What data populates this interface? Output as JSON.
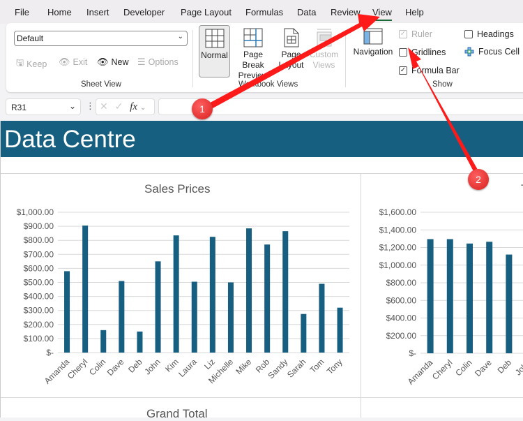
{
  "menu": {
    "tabs": [
      {
        "label": "File"
      },
      {
        "label": "Home"
      },
      {
        "label": "Insert"
      },
      {
        "label": "Developer"
      },
      {
        "label": "Page Layout"
      },
      {
        "label": "Formulas"
      },
      {
        "label": "Data"
      },
      {
        "label": "Review"
      },
      {
        "label": "View",
        "active": true
      },
      {
        "label": "Help"
      }
    ]
  },
  "ribbon": {
    "sheet_view": {
      "label": "Sheet View",
      "select_value": "Default",
      "keep": "Keep",
      "exit": "Exit",
      "new": "New",
      "options": "Options"
    },
    "workbook_views": {
      "label": "Workbook Views",
      "normal": "Normal",
      "page_break_1": "Page Break",
      "page_break_2": "Preview",
      "page_layout_1": "Page",
      "page_layout_2": "Layout",
      "custom_views_1": "Custom",
      "custom_views_2": "Views"
    },
    "navigation": {
      "label": "Navigation"
    },
    "show": {
      "label": "Show",
      "ruler": {
        "label": "Ruler",
        "checked": true,
        "enabled": false
      },
      "gridlines": {
        "label": "Gridlines",
        "checked": false
      },
      "formula_bar": {
        "label": "Formula Bar",
        "checked": true
      },
      "headings": {
        "label": "Headings",
        "checked": false
      },
      "focus_cell": {
        "label": "Focus Cell"
      }
    }
  },
  "formula_bar": {
    "name_box": "R31",
    "fx": "fx",
    "value": ""
  },
  "sheet": {
    "banner_title": "Data Centre",
    "grand_total_title": "Grand Total",
    "banner_color": "#175f80"
  },
  "annotations": [
    {
      "number": "1"
    },
    {
      "number": "2"
    }
  ],
  "chart_data": [
    {
      "type": "bar",
      "title": "Sales Prices",
      "xlabel": "",
      "ylabel": "",
      "ylim": [
        0,
        1000
      ],
      "yticks": [
        "$-",
        "$100.00",
        "$200.00",
        "$300.00",
        "$400.00",
        "$500.00",
        "$600.00",
        "$700.00",
        "$800.00",
        "$900.00",
        "$1,000.00"
      ],
      "grid": true,
      "bar_color": "#175f80",
      "categories": [
        "Amanda",
        "Cheryl",
        "Colin",
        "Dave",
        "Deb",
        "John",
        "Kim",
        "Laura",
        "Liz",
        "Michelle",
        "Mike",
        "Rob",
        "Sandy",
        "Sarah",
        "Tom",
        "Tony"
      ],
      "values": [
        580,
        905,
        160,
        510,
        150,
        650,
        835,
        505,
        825,
        500,
        885,
        770,
        865,
        275,
        490,
        320
      ]
    },
    {
      "type": "bar",
      "title": "T",
      "xlabel": "",
      "ylabel": "",
      "ylim": [
        0,
        1600
      ],
      "yticks": [
        "$-",
        "$200.00",
        "$400.00",
        "$600.00",
        "$800.00",
        "$1,000.00",
        "$1,200.00",
        "$1,400.00",
        "$1,600.00"
      ],
      "grid": true,
      "bar_color": "#175f80",
      "categories": [
        "Amanda",
        "Cheryl",
        "Colin",
        "Dave",
        "Deb",
        "John"
      ],
      "values": [
        1295,
        1295,
        1245,
        1265,
        1120,
        null
      ]
    }
  ]
}
